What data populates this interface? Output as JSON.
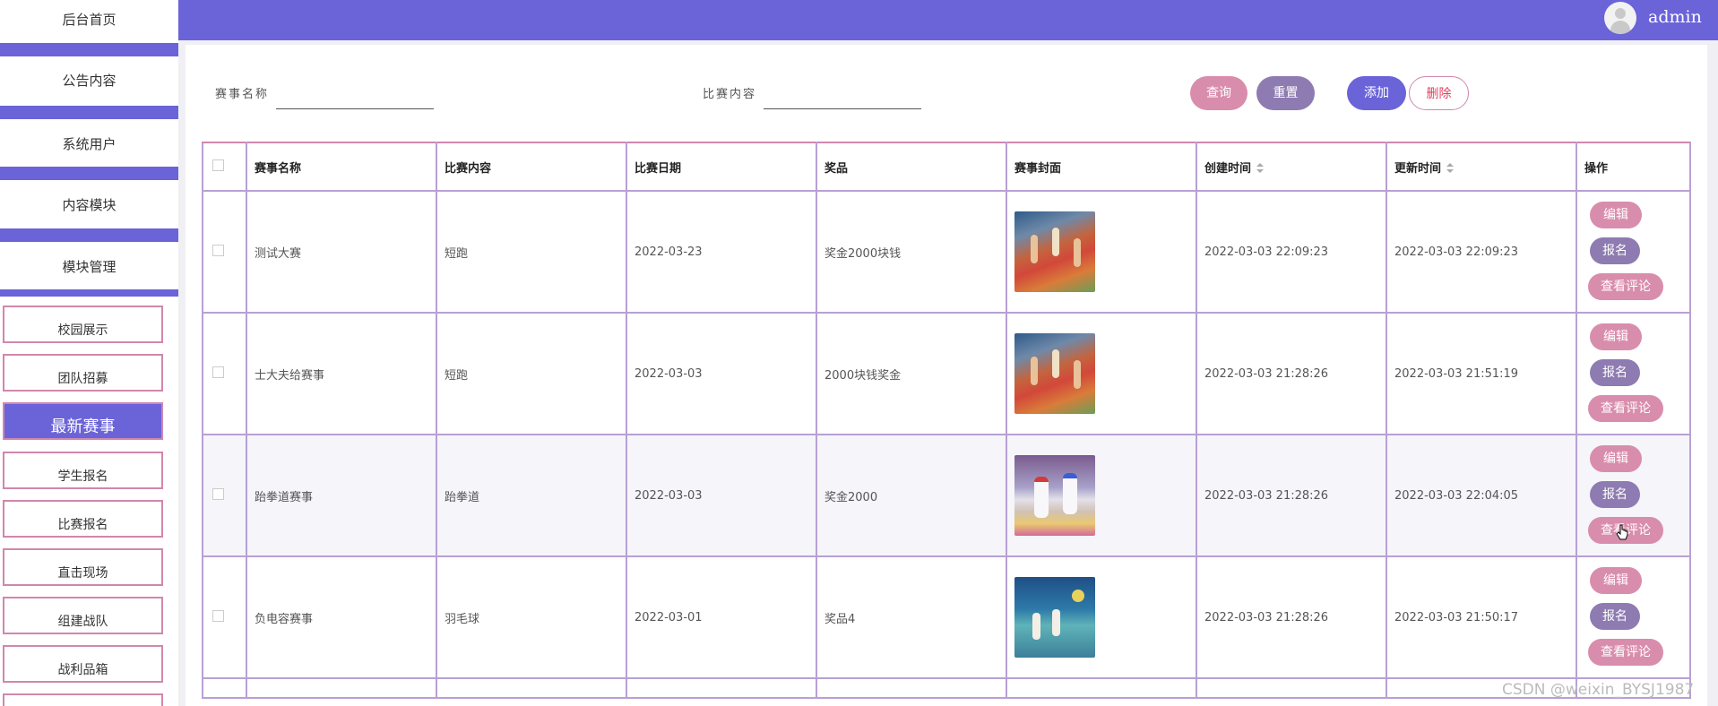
{
  "sidebar": {
    "top_items": [
      "后台首页",
      "公告内容",
      "系统用户",
      "内容模块",
      "模块管理"
    ],
    "sub_items": [
      "校园展示",
      "团队招募",
      "最新赛事",
      "学生报名",
      "比赛报名",
      "直击现场",
      "组建战队",
      "战利品箱"
    ],
    "active_item": "最新赛事"
  },
  "header": {
    "username": "admin"
  },
  "search": {
    "event_name_label": "赛事名称",
    "event_content_label": "比赛内容",
    "event_name_value": "",
    "event_content_value": ""
  },
  "buttons": {
    "query": "查询",
    "reset": "重置",
    "add": "添加",
    "delete": "删除"
  },
  "table": {
    "headers": [
      "赛事名称",
      "比赛内容",
      "比赛日期",
      "奖品",
      "赛事封面",
      "创建时间",
      "更新时间",
      "操作"
    ],
    "rows": [
      {
        "name": "测试大赛",
        "content": "短跑",
        "date": "2022-03-23",
        "prize": "奖金2000块钱",
        "cover": "track-icon",
        "created": "2022-03-03 22:09:23",
        "updated": "2022-03-03 22:09:23"
      },
      {
        "name": "士大夫给赛事",
        "content": "短跑",
        "date": "2022-03-03",
        "prize": "2000块钱奖金",
        "cover": "track-icon",
        "created": "2022-03-03 21:28:26",
        "updated": "2022-03-03 21:51:19"
      },
      {
        "name": "跆拳道赛事",
        "content": "跆拳道",
        "date": "2022-03-03",
        "prize": "奖金2000",
        "cover": "taekwondo-icon",
        "created": "2022-03-03 21:28:26",
        "updated": "2022-03-03 22:04:05"
      },
      {
        "name": "负电容赛事",
        "content": "羽毛球",
        "date": "2022-03-01",
        "prize": "奖品4",
        "cover": "badminton-icon",
        "created": "2022-03-03 21:28:26",
        "updated": "2022-03-03 21:50:17"
      }
    ],
    "row_actions": {
      "edit": "编辑",
      "signup": "报名",
      "view_comments": "查看评论"
    }
  },
  "watermark": "CSDN @weixin_BYSJ1987",
  "colors": {
    "accent": "#6b63d8",
    "pink": "#d98dac",
    "purple": "#8e7bb1",
    "border_pink": "#d187ad"
  }
}
